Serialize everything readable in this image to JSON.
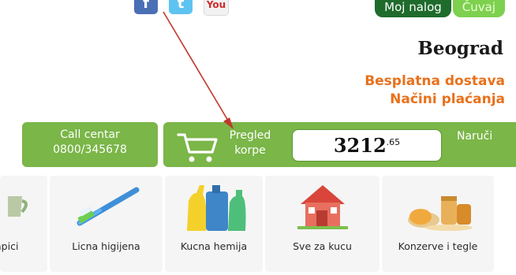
{
  "social": {
    "facebook_glyph": "f",
    "twitter_glyph": "t",
    "youtube_glyph": "You",
    "icons": [
      "facebook-icon",
      "twitter-icon",
      "youtube-icon"
    ]
  },
  "account": {
    "my_account_label": "Moj nalog",
    "save_label": "Čuvaj"
  },
  "info": {
    "city": "Beograd",
    "free_delivery": "Besplatna dostava",
    "payment_methods": "Načini plaćanja"
  },
  "call_center": {
    "title": "Call centar",
    "phone": "0800/345678"
  },
  "cart": {
    "label_line1": "Pregled",
    "label_line2": "korpe",
    "total_int": "3212",
    "total_dec": ".65",
    "order_label": "Naruči"
  },
  "categories": [
    {
      "label": "apici",
      "icon": "cup-icon"
    },
    {
      "label": "Licna higijena",
      "icon": "toothbrush-icon"
    },
    {
      "label": "Kucna hemija",
      "icon": "detergent-bottles-icon"
    },
    {
      "label": "Sve za kucu",
      "icon": "house-icon"
    },
    {
      "label": "Konzerve i tegle",
      "icon": "jars-icon"
    }
  ],
  "colors": {
    "bar_green": "#7ab648",
    "dark_green": "#1f6b2c",
    "orange": "#e8711c",
    "annotation_red": "#c0392b"
  }
}
